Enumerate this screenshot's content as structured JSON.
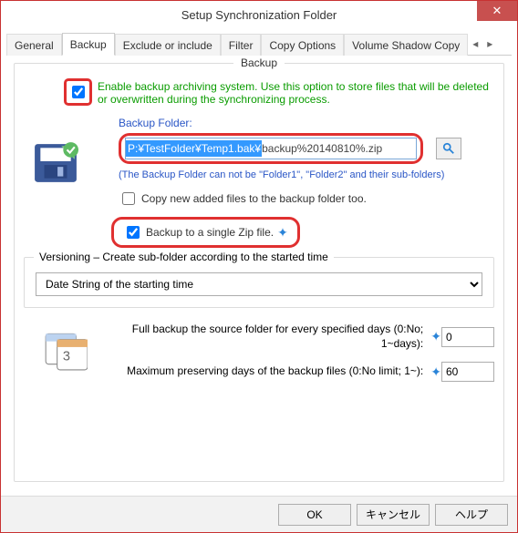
{
  "window": {
    "title": "Setup Synchronization Folder"
  },
  "tabs": {
    "items": [
      "General",
      "Backup",
      "Exclude or include",
      "Filter",
      "Copy Options",
      "Volume Shadow Copy"
    ],
    "active": 1,
    "left_arrow": "◂",
    "right_arrow": "▸"
  },
  "group": {
    "title": "Backup",
    "enable_label": "Enable backup archiving system. Use this option to store files that will be deleted or overwritten during the synchronizing process.",
    "backup_folder_label": "Backup Folder:",
    "path_selected": "P:¥TestFolder¥Temp1.bak¥",
    "path_rest": "backup%20140810%.zip",
    "note": "(The Backup Folder can not be \"Folder1\", \"Folder2\" and their sub-folders)",
    "copy_new_label": "Copy new added files to the backup folder too.",
    "zip_label": "Backup to a single Zip file.",
    "versioning_title": "Versioning – Create sub-folder according to the started time",
    "versioning_value": "Date String of the starting time",
    "full_backup_label": "Full backup the source folder for every specified days (0:No; 1~days):",
    "full_backup_value": "0",
    "max_days_label": "Maximum preserving days of the backup files (0:No limit; 1~):",
    "max_days_value": "60"
  },
  "buttons": {
    "ok": "OK",
    "cancel": "キャンセル",
    "help": "ヘルプ"
  },
  "close_x": "✕"
}
